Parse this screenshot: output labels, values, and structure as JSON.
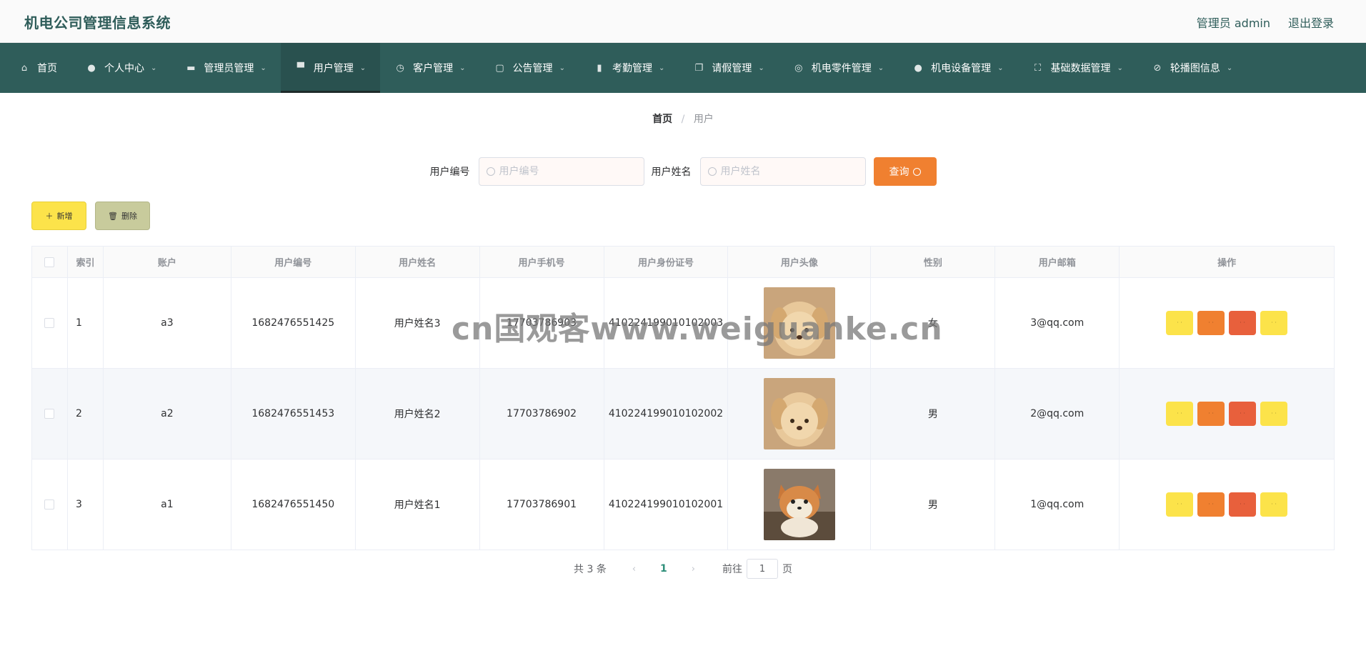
{
  "header": {
    "app_title": "机电公司管理信息系统",
    "user_label": "管理员 admin",
    "logout_label": "退出登录"
  },
  "nav": {
    "items": [
      {
        "label": "首页",
        "icon": "home-icon",
        "dropdown": false
      },
      {
        "label": "个人中心",
        "icon": "user-icon",
        "dropdown": true
      },
      {
        "label": "管理员管理",
        "icon": "box-icon",
        "dropdown": true
      },
      {
        "label": "用户管理",
        "icon": "brush-icon",
        "dropdown": true,
        "active": true
      },
      {
        "label": "客户管理",
        "icon": "dashboard-icon",
        "dropdown": true
      },
      {
        "label": "公告管理",
        "icon": "chat-icon",
        "dropdown": true
      },
      {
        "label": "考勤管理",
        "icon": "books-icon",
        "dropdown": true
      },
      {
        "label": "请假管理",
        "icon": "copy-icon",
        "dropdown": true
      },
      {
        "label": "机电零件管理",
        "icon": "aperture-icon",
        "dropdown": true
      },
      {
        "label": "机电设备管理",
        "icon": "user-icon",
        "dropdown": true
      },
      {
        "label": "基础数据管理",
        "icon": "fullscreen-icon",
        "dropdown": true
      },
      {
        "label": "轮播图信息",
        "icon": "bell-off-icon",
        "dropdown": true
      }
    ]
  },
  "breadcrumb": {
    "home": "首页",
    "separator": "/",
    "current": "用户"
  },
  "search": {
    "field1_label": "用户编号",
    "field1_placeholder": "用户编号",
    "field2_label": "用户姓名",
    "field2_placeholder": "用户姓名",
    "query_label": "查询"
  },
  "actions": {
    "add_label": "新增",
    "delete_label": "删除"
  },
  "table": {
    "headers": [
      "索引",
      "账户",
      "用户编号",
      "用户姓名",
      "用户手机号",
      "用户身份证号",
      "用户头像",
      "性别",
      "用户邮箱",
      "操作"
    ],
    "rows": [
      {
        "index": "1",
        "account": "a3",
        "user_no": "1682476551425",
        "name": "用户姓名3",
        "phone": "17703786903",
        "id_card": "410224199010102003",
        "avatar": "puppy-cream",
        "gender": "女",
        "email": "3@qq.com"
      },
      {
        "index": "2",
        "account": "a2",
        "user_no": "1682476551453",
        "name": "用户姓名2",
        "phone": "17703786902",
        "id_card": "410224199010102002",
        "avatar": "puppy-cream",
        "gender": "男",
        "email": "2@qq.com"
      },
      {
        "index": "3",
        "account": "a1",
        "user_no": "1682476551450",
        "name": "用户姓名1",
        "phone": "17703786901",
        "id_card": "410224199010102001",
        "avatar": "shiba-dog",
        "gender": "男",
        "email": "1@qq.com"
      }
    ]
  },
  "pagination": {
    "total_label": "共 3 条",
    "current_page": "1",
    "goto_label": "前往",
    "goto_value": "1",
    "page_unit": "页"
  },
  "watermark": "cn国观客www.weiguanke.cn",
  "colors": {
    "primary": "#2f5d5a",
    "accent_orange": "#f08030",
    "btn_yellow": "#fce34a",
    "btn_red": "#e8603c",
    "btn_khaki": "#c8cb9c"
  }
}
